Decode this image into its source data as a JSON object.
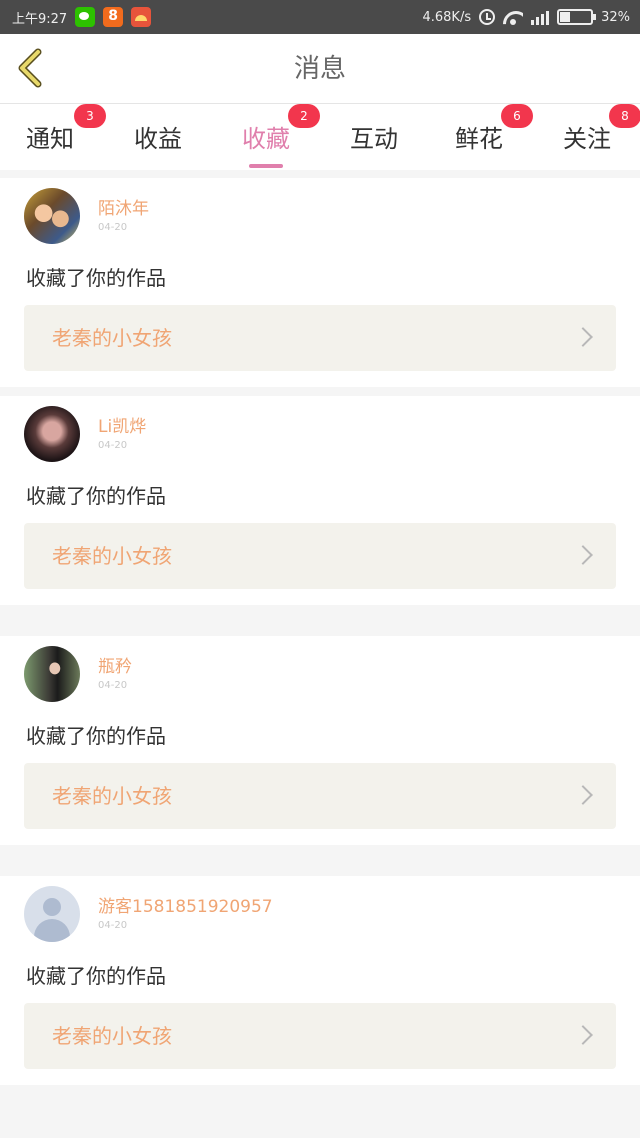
{
  "status_bar": {
    "time": "上午9:27",
    "network_speed": "4.68K/s",
    "battery": "32%",
    "apps": [
      "wechat-icon",
      "app-8-icon",
      "app-red-icon"
    ]
  },
  "header": {
    "title": "消息",
    "back_icon": "chevron-left-icon"
  },
  "tabs": [
    {
      "label": "通知",
      "badge": "3",
      "active": false
    },
    {
      "label": "收益",
      "badge": "",
      "active": false
    },
    {
      "label": "收藏",
      "badge": "2",
      "active": true
    },
    {
      "label": "互动",
      "badge": "",
      "active": false
    },
    {
      "label": "鲜花",
      "badge": "6",
      "active": false
    },
    {
      "label": "关注",
      "badge": "8",
      "active": false
    }
  ],
  "items": [
    {
      "username": "陌沐年",
      "date": "04-20",
      "action": "收藏了你的作品",
      "work_title": "老秦的小女孩"
    },
    {
      "username": "Li凯烨",
      "date": "04-20",
      "action": "收藏了你的作品",
      "work_title": "老秦的小女孩"
    },
    {
      "username": "瓶矜",
      "date": "04-20",
      "action": "收藏了你的作品",
      "work_title": "老秦的小女孩"
    },
    {
      "username": "游客15818519209​57",
      "date": "04-20",
      "action": "收藏了你的作品",
      "work_title": "老秦的小女孩"
    }
  ],
  "colors": {
    "accent": "#e07fac",
    "username": "#f0a574",
    "badge": "#f2364d",
    "back_icon": "#d4c24a"
  }
}
